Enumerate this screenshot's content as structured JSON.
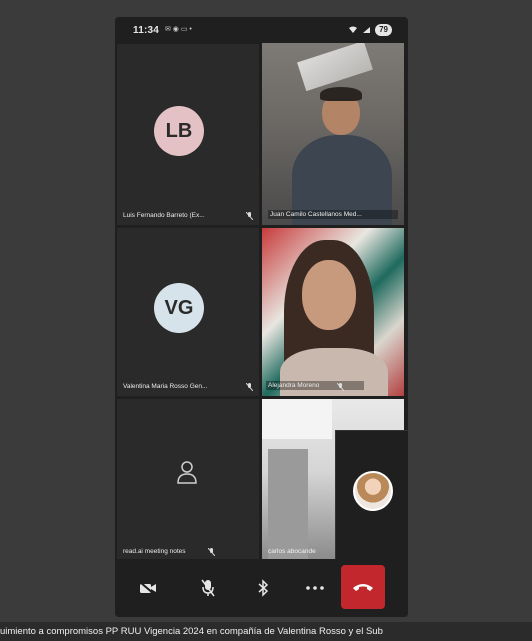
{
  "status_bar": {
    "time": "11:34",
    "icons_left": "✉ ◉ ▭ •",
    "battery": "79"
  },
  "participants": [
    {
      "initials": "LB",
      "name": "Luis Fernando Barreto (Ex...",
      "avatar_color": "#e4c1c4",
      "muted": true
    },
    {
      "name": "Juan Camilo Castellanos Med...",
      "muted": false,
      "active_speaker": true
    },
    {
      "initials": "VG",
      "name": "Valentina Maria Rosso Gen...",
      "avatar_color": "#d7e3ea",
      "muted": true
    },
    {
      "name": "Alejandra Moreno",
      "muted": true
    },
    {
      "name": "read.ai meeting notes",
      "muted": true,
      "icon": "person-outline-icon"
    },
    {
      "name": "carlos abocande",
      "muted": false
    }
  ],
  "controls": [
    "camera-off-icon",
    "mic-off-icon",
    "bluetooth-icon",
    "more-icon",
    "end-call-icon"
  ],
  "colors": {
    "end_call": "#c1272d",
    "active_border": "#5b6bd6"
  },
  "caption": "uimiento a compromisos PP RUU Vigencia 2024 en compañía de Valentina Rosso y el Sub"
}
